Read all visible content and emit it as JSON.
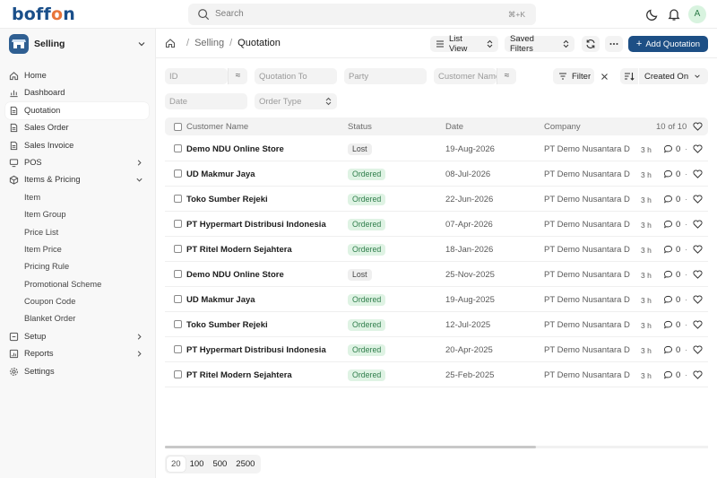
{
  "topbar": {
    "logo_parts": [
      "boff",
      "o",
      "n"
    ],
    "search_placeholder": "Search",
    "search_shortcut": "⌘+K",
    "avatar_initial": "A"
  },
  "sidebar": {
    "app_name": "Selling",
    "items": [
      {
        "label": "Home",
        "icon": "home-icon",
        "active": false,
        "chevron": false,
        "sub": false
      },
      {
        "label": "Dashboard",
        "icon": "dashboard-icon",
        "active": false,
        "chevron": false,
        "sub": false
      },
      {
        "label": "Quotation",
        "icon": "document-icon",
        "active": true,
        "chevron": false,
        "sub": false
      },
      {
        "label": "Sales Order",
        "icon": "document-icon",
        "active": false,
        "chevron": false,
        "sub": false
      },
      {
        "label": "Sales Invoice",
        "icon": "document-icon",
        "active": false,
        "chevron": false,
        "sub": false
      },
      {
        "label": "POS",
        "icon": "pos-icon",
        "active": false,
        "chevron": "right",
        "sub": false
      },
      {
        "label": "Items & Pricing",
        "icon": "box-icon",
        "active": false,
        "chevron": "down",
        "sub": false
      },
      {
        "label": "Item",
        "icon": "",
        "active": false,
        "chevron": false,
        "sub": true
      },
      {
        "label": "Item Group",
        "icon": "",
        "active": false,
        "chevron": false,
        "sub": true
      },
      {
        "label": "Price List",
        "icon": "",
        "active": false,
        "chevron": false,
        "sub": true
      },
      {
        "label": "Item Price",
        "icon": "",
        "active": false,
        "chevron": false,
        "sub": true
      },
      {
        "label": "Pricing Rule",
        "icon": "",
        "active": false,
        "chevron": false,
        "sub": true
      },
      {
        "label": "Promotional Scheme",
        "icon": "",
        "active": false,
        "chevron": false,
        "sub": true
      },
      {
        "label": "Coupon Code",
        "icon": "",
        "active": false,
        "chevron": false,
        "sub": true
      },
      {
        "label": "Blanket Order",
        "icon": "",
        "active": false,
        "chevron": false,
        "sub": true
      },
      {
        "label": "Setup",
        "icon": "setup-icon",
        "active": false,
        "chevron": "right",
        "sub": false
      },
      {
        "label": "Reports",
        "icon": "reports-icon",
        "active": false,
        "chevron": "right",
        "sub": false
      },
      {
        "label": "Settings",
        "icon": "gear-icon",
        "active": false,
        "chevron": false,
        "sub": false
      }
    ]
  },
  "header": {
    "breadcrumb": [
      "Selling",
      "Quotation"
    ],
    "list_view_label": "List View",
    "saved_filters_label": "Saved Filters",
    "add_label": "Add Quotation"
  },
  "filters": {
    "id_placeholder": "ID",
    "quotation_to_placeholder": "Quotation To",
    "party_placeholder": "Party",
    "customer_name_placeholder": "Customer Name",
    "date_placeholder": "Date",
    "order_type_placeholder": "Order Type",
    "filter_label": "Filter",
    "sort_label": "Created On"
  },
  "table": {
    "columns": {
      "customer": "Customer Name",
      "status": "Status",
      "date": "Date",
      "company": "Company"
    },
    "count": "10 of 10",
    "rows": [
      {
        "customer": "Demo NDU Online Store",
        "status": "Lost",
        "date": "19-Aug-2026",
        "company": "PT Demo Nusantara Digital",
        "since": "3 h",
        "comments": "0"
      },
      {
        "customer": "UD Makmur Jaya",
        "status": "Ordered",
        "date": "08-Jul-2026",
        "company": "PT Demo Nusantara Digital",
        "since": "3 h",
        "comments": "0"
      },
      {
        "customer": "Toko Sumber Rejeki",
        "status": "Ordered",
        "date": "22-Jun-2026",
        "company": "PT Demo Nusantara Digital",
        "since": "3 h",
        "comments": "0"
      },
      {
        "customer": "PT Hypermart Distribusi Indonesia",
        "status": "Ordered",
        "date": "07-Apr-2026",
        "company": "PT Demo Nusantara Digital",
        "since": "3 h",
        "comments": "0"
      },
      {
        "customer": "PT Ritel Modern Sejahtera",
        "status": "Ordered",
        "date": "18-Jan-2026",
        "company": "PT Demo Nusantara Digital",
        "since": "3 h",
        "comments": "0"
      },
      {
        "customer": "Demo NDU Online Store",
        "status": "Lost",
        "date": "25-Nov-2025",
        "company": "PT Demo Nusantara Digital",
        "since": "3 h",
        "comments": "0"
      },
      {
        "customer": "UD Makmur Jaya",
        "status": "Ordered",
        "date": "19-Aug-2025",
        "company": "PT Demo Nusantara Digital",
        "since": "3 h",
        "comments": "0"
      },
      {
        "customer": "Toko Sumber Rejeki",
        "status": "Ordered",
        "date": "12-Jul-2025",
        "company": "PT Demo Nusantara Digital",
        "since": "3 h",
        "comments": "0"
      },
      {
        "customer": "PT Hypermart Distribusi Indonesia",
        "status": "Ordered",
        "date": "20-Apr-2025",
        "company": "PT Demo Nusantara Digital",
        "since": "3 h",
        "comments": "0"
      },
      {
        "customer": "PT Ritel Modern Sejahtera",
        "status": "Ordered",
        "date": "25-Feb-2025",
        "company": "PT Demo Nusantara Digital",
        "since": "3 h",
        "comments": "0"
      }
    ]
  },
  "pager": {
    "sizes": [
      "20",
      "100",
      "500",
      "2500"
    ],
    "selected": "20"
  },
  "colors": {
    "brand": "#1d4f85",
    "logo_accent": "#e8753a",
    "ordered_bg": "#dff3e4",
    "ordered_text": "#2e7d4a"
  }
}
